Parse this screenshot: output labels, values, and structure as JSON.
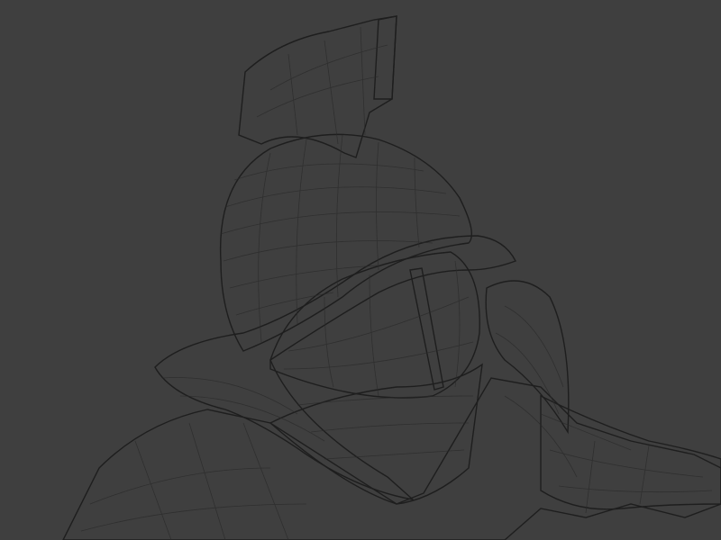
{
  "scene": {
    "subject": "gladiator-helmet-wireframe-render",
    "colors": {
      "background": "#3f3f3f",
      "mesh_light": "#b9b9b9",
      "mesh_mid": "#8e8e8e",
      "mesh_dark": "#5a5a5a",
      "wire": "#2a2a2a"
    }
  }
}
